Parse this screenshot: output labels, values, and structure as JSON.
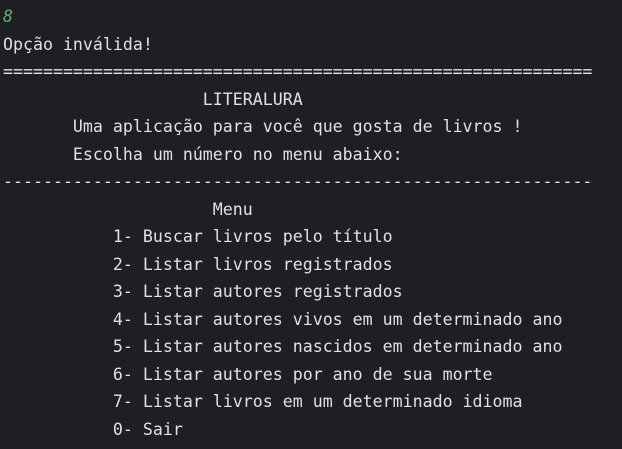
{
  "terminal": {
    "colors": {
      "background": "#1e1f22",
      "text": "#dfe1e5",
      "user_input": "#6aab73"
    },
    "lines": [
      "8",
      "Opção inválida!",
      "===========================================================",
      "                    LITERALURA",
      "       Uma aplicação para você que gosta de livros !",
      "       Escolha um número no menu abaixo:",
      "-----------------------------------------------------------",
      "                     Menu",
      "           1- Buscar livros pelo título",
      "           2- Listar livros registrados",
      "           3- Listar autores registrados",
      "           4- Listar autores vivos em um determinado ano",
      "           5- Listar autores nascidos em determinado ano",
      "           6- Listar autores por ano de sua morte",
      "           7- Listar livros em um determinado idioma",
      "           0- Sair"
    ]
  }
}
